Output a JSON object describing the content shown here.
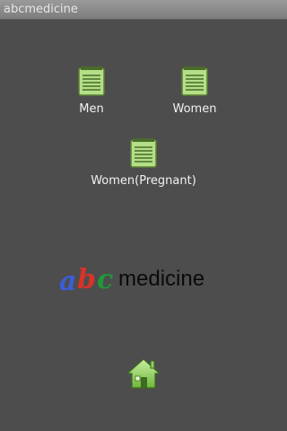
{
  "window": {
    "title": "abcmedicine"
  },
  "menu": {
    "items": [
      {
        "label": "Men",
        "icon": "notepad-icon"
      },
      {
        "label": "Women",
        "icon": "notepad-icon"
      },
      {
        "label": "Women(Pregnant)",
        "icon": "notepad-icon"
      }
    ]
  },
  "logo": {
    "letters": [
      "a",
      "b",
      "c"
    ],
    "word": "medicine",
    "colors": {
      "a": "#3a5ed8",
      "b": "#d8322a",
      "c": "#1f9a3a",
      "word": "#0a0a0a"
    }
  },
  "footer": {
    "home_icon": "home-icon"
  },
  "colors": {
    "background": "#4d4d4d",
    "icon_green": "#b3df86",
    "icon_dark": "#4a6a2a"
  }
}
